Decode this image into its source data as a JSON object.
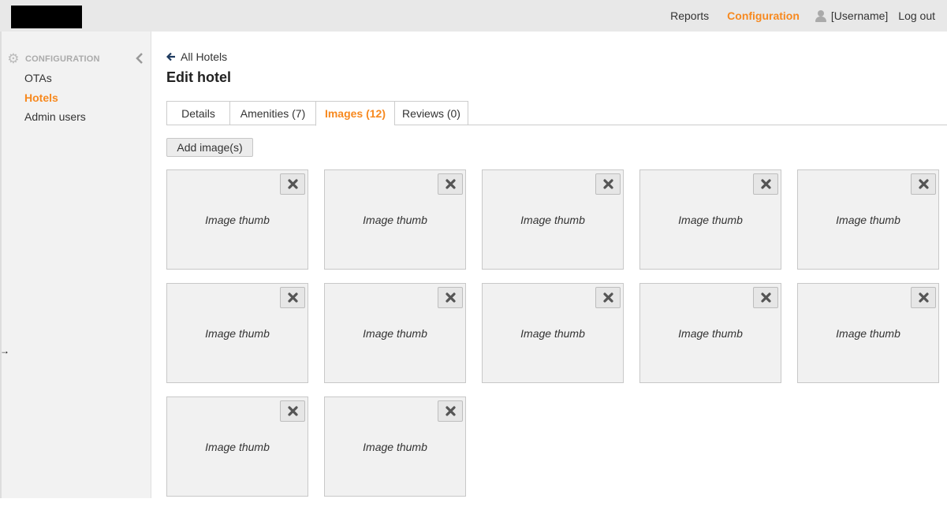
{
  "header": {
    "nav": {
      "reports": "Reports",
      "configuration": "Configuration",
      "username": "[Username]",
      "logout": "Log out"
    }
  },
  "sidebar": {
    "section_title": "CONFIGURATION",
    "items": [
      {
        "label": "OTAs",
        "active": false
      },
      {
        "label": "Hotels",
        "active": true
      },
      {
        "label": "Admin users",
        "active": false
      }
    ]
  },
  "main": {
    "back_link": "All Hotels",
    "title": "Edit hotel",
    "tabs": [
      {
        "label": "Details",
        "active": false
      },
      {
        "label": "Amenities (7)",
        "active": false
      },
      {
        "label": "Images (12)",
        "active": true
      },
      {
        "label": "Reviews (0)",
        "active": false
      }
    ],
    "add_button": "Add image(s)",
    "images": [
      "Image thumb",
      "Image thumb",
      "Image thumb",
      "Image thumb",
      "Image thumb",
      "Image thumb",
      "Image thumb",
      "Image thumb",
      "Image thumb",
      "Image thumb",
      "Image thumb",
      "Image thumb"
    ]
  },
  "colors": {
    "accent": "#f7891f",
    "topbar": "#e8e8e8",
    "sidebar": "#f2f2f2"
  },
  "icons": {
    "sidebar_section": "gear-icon",
    "sidebar_collapse": "chevron-left-icon",
    "back": "arrow-left-icon",
    "user": "user-icon",
    "remove": "close-icon"
  }
}
